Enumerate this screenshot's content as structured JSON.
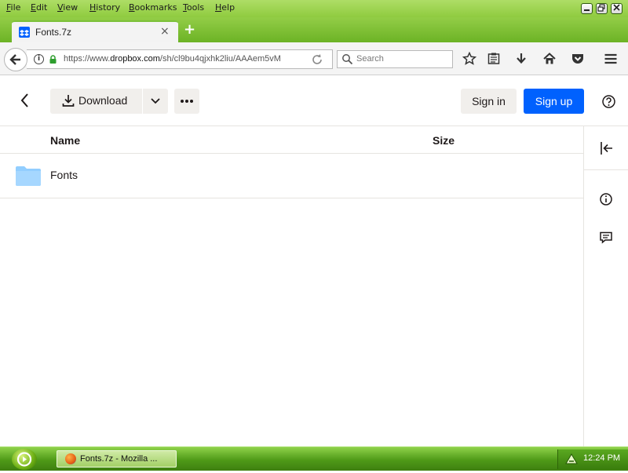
{
  "browser": {
    "menu": [
      "File",
      "Edit",
      "View",
      "History",
      "Bookmarks",
      "Tools",
      "Help"
    ],
    "tab": {
      "title": "Fonts.7z",
      "close": "×"
    },
    "new_tab": "+",
    "url": {
      "prefix": "https://www.",
      "domain": "dropbox.com",
      "path": "/sh/cl9bu4qjxhk2liu/AAAem5vM"
    },
    "search_placeholder": "Search",
    "accent": "#8fcb3f"
  },
  "page": {
    "toolbar": {
      "download_label": "Download",
      "signin_label": "Sign in",
      "signup_label": "Sign up"
    },
    "columns": {
      "name": "Name",
      "size": "Size"
    },
    "files": [
      {
        "name": "Fonts",
        "type": "folder"
      }
    ],
    "brand_color": "#0061fe"
  },
  "taskbar": {
    "task_label": "Fonts.7z - Mozilla ...",
    "clock": "12:24 PM"
  }
}
